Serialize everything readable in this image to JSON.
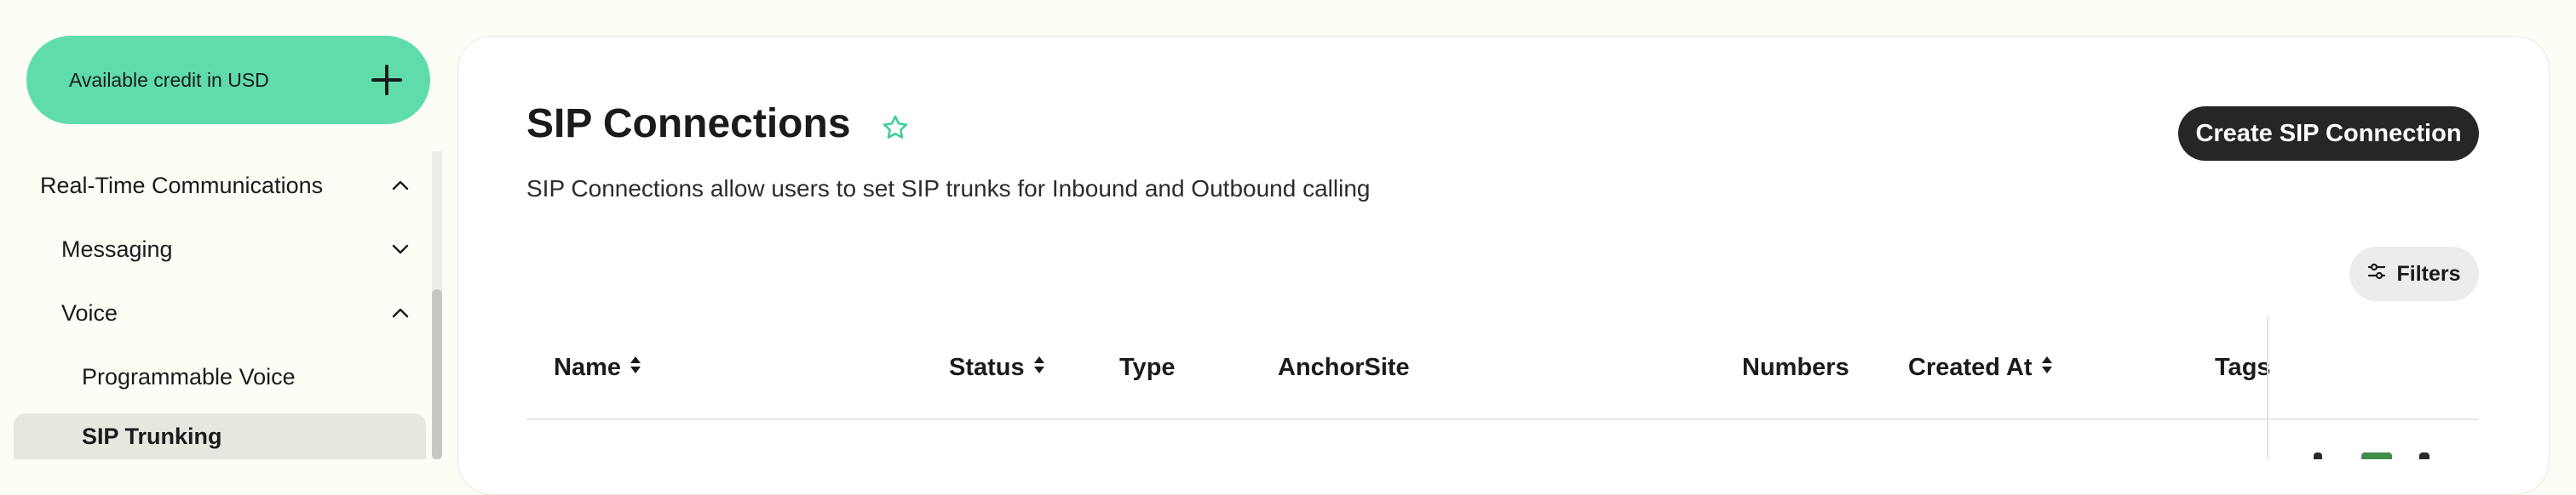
{
  "sidebar": {
    "credit_label": "Available credit in USD",
    "nav": [
      {
        "label": "Real-Time Communications",
        "expanded": true
      },
      {
        "label": "Messaging",
        "expanded": false
      },
      {
        "label": "Voice",
        "expanded": true
      },
      {
        "label": "Programmable Voice"
      },
      {
        "label": "SIP Trunking",
        "active": true
      }
    ]
  },
  "page": {
    "title": "SIP Connections",
    "description": "SIP Connections allow users to set SIP trunks for Inbound and Outbound calling",
    "create_button": "Create SIP Connection",
    "filters_button": "Filters"
  },
  "table": {
    "columns": [
      {
        "label": "Name",
        "sortable": true
      },
      {
        "label": "Status",
        "sortable": true
      },
      {
        "label": "Type",
        "sortable": false
      },
      {
        "label": "AnchorSite",
        "sortable": false
      },
      {
        "label": "Numbers",
        "sortable": false
      },
      {
        "label": "Created At",
        "sortable": true
      },
      {
        "label": "Tags",
        "sortable": false
      }
    ]
  },
  "colors": {
    "accent": "#5fdcaa",
    "primary_button": "#262626",
    "active_nav_bg": "#e7e6df",
    "page_bg": "#fdfdf6"
  },
  "icons": [
    "plus-icon",
    "chevron-up-icon",
    "chevron-down-icon",
    "star-icon",
    "sliders-icon",
    "sort-icon"
  ]
}
